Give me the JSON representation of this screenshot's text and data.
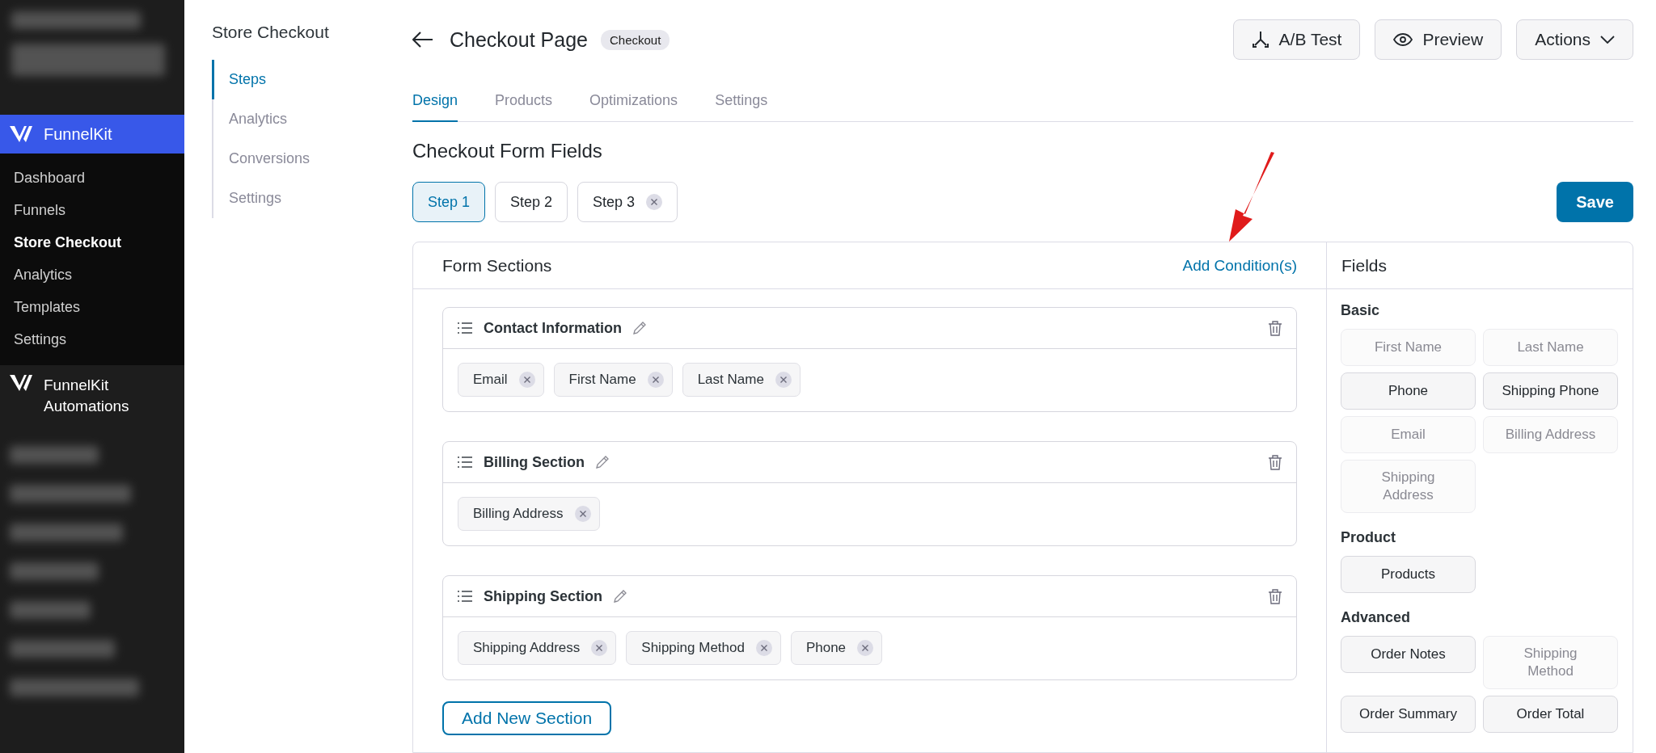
{
  "wp_menu": {
    "brand": "FunnelKit",
    "items": [
      {
        "label": "Dashboard",
        "selected": false
      },
      {
        "label": "Funnels",
        "selected": false
      },
      {
        "label": "Store Checkout",
        "selected": true
      },
      {
        "label": "Analytics",
        "selected": false
      },
      {
        "label": "Templates",
        "selected": false
      },
      {
        "label": "Settings",
        "selected": false
      }
    ],
    "automations": "FunnelKit Automations"
  },
  "subnav": {
    "title": "Store Checkout",
    "items": [
      {
        "label": "Steps",
        "selected": true
      },
      {
        "label": "Analytics",
        "selected": false
      },
      {
        "label": "Conversions",
        "selected": false
      },
      {
        "label": "Settings",
        "selected": false
      }
    ]
  },
  "header": {
    "title": "Checkout Page",
    "badge": "Checkout",
    "buttons": [
      {
        "label": "A/B Test",
        "kind": "split"
      },
      {
        "label": "Preview",
        "kind": "preview"
      },
      {
        "label": "Actions",
        "kind": "dropdown"
      }
    ]
  },
  "tabs": [
    {
      "label": "Design",
      "selected": true
    },
    {
      "label": "Products",
      "selected": false
    },
    {
      "label": "Optimizations",
      "selected": false
    },
    {
      "label": "Settings",
      "selected": false
    }
  ],
  "heading": "Checkout Form Fields",
  "steps": [
    {
      "label": "Step 1",
      "selected": true,
      "removable": false
    },
    {
      "label": "Step 2",
      "selected": false,
      "removable": false
    },
    {
      "label": "Step 3",
      "selected": false,
      "removable": true
    }
  ],
  "save": "Save",
  "form_sections": {
    "title": "Form Sections",
    "link": "Add Condition(s)",
    "sections": [
      {
        "name": "Contact Information",
        "fields": [
          "Email",
          "First Name",
          "Last Name"
        ]
      },
      {
        "name": "Billing Section",
        "fields": [
          "Billing Address"
        ]
      },
      {
        "name": "Shipping Section",
        "fields": [
          "Shipping Address",
          "Shipping Method",
          "Phone"
        ]
      }
    ],
    "add_button": "Add New Section"
  },
  "fields_panel": {
    "title": "Fields",
    "groups": [
      {
        "name": "Basic",
        "items": [
          {
            "label": "First Name",
            "disabled": true
          },
          {
            "label": "Last Name",
            "disabled": true
          },
          {
            "label": "Phone",
            "disabled": false
          },
          {
            "label": "Shipping Phone",
            "disabled": false
          },
          {
            "label": "Email",
            "disabled": true
          },
          {
            "label": "Billing Address",
            "disabled": true
          },
          {
            "label": "Shipping Address",
            "disabled": true
          }
        ]
      },
      {
        "name": "Product",
        "items": [
          {
            "label": "Products",
            "disabled": false
          }
        ]
      },
      {
        "name": "Advanced",
        "items": [
          {
            "label": "Order Notes",
            "disabled": false
          },
          {
            "label": "Shipping Method",
            "disabled": true
          },
          {
            "label": "Order Summary",
            "disabled": false
          },
          {
            "label": "Order Total",
            "disabled": false
          }
        ]
      }
    ]
  }
}
